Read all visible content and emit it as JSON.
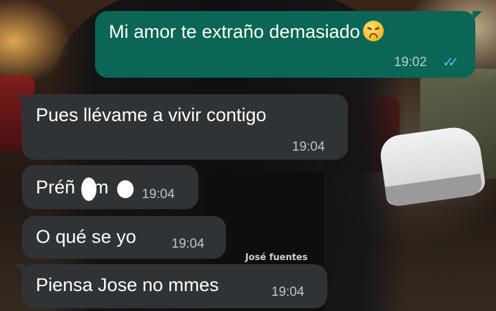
{
  "chat": {
    "messages": [
      {
        "direction": "outgoing",
        "text": "Mi amor te extraño demasiado",
        "emoji": "weary-face-icon",
        "time": "19:02",
        "status": "read"
      },
      {
        "direction": "incoming",
        "text": "Pues llévame a vivir contigo",
        "time": "19:04"
      },
      {
        "direction": "incoming",
        "text_before": "Préñ",
        "text_middle": "m",
        "text_after": "",
        "time": "19:04"
      },
      {
        "direction": "incoming",
        "text": "O qué se yo",
        "time": "19:04"
      },
      {
        "direction": "incoming",
        "text": "Piensa Jose no mmes",
        "time": "19:04"
      }
    ],
    "read_receipt_icon": "double-check-icon"
  },
  "watermark": "José fuentes",
  "colors": {
    "outgoing_bubble": "#0b6656",
    "incoming_bubble": "#303336",
    "read_ticks": "#53bdeb"
  }
}
